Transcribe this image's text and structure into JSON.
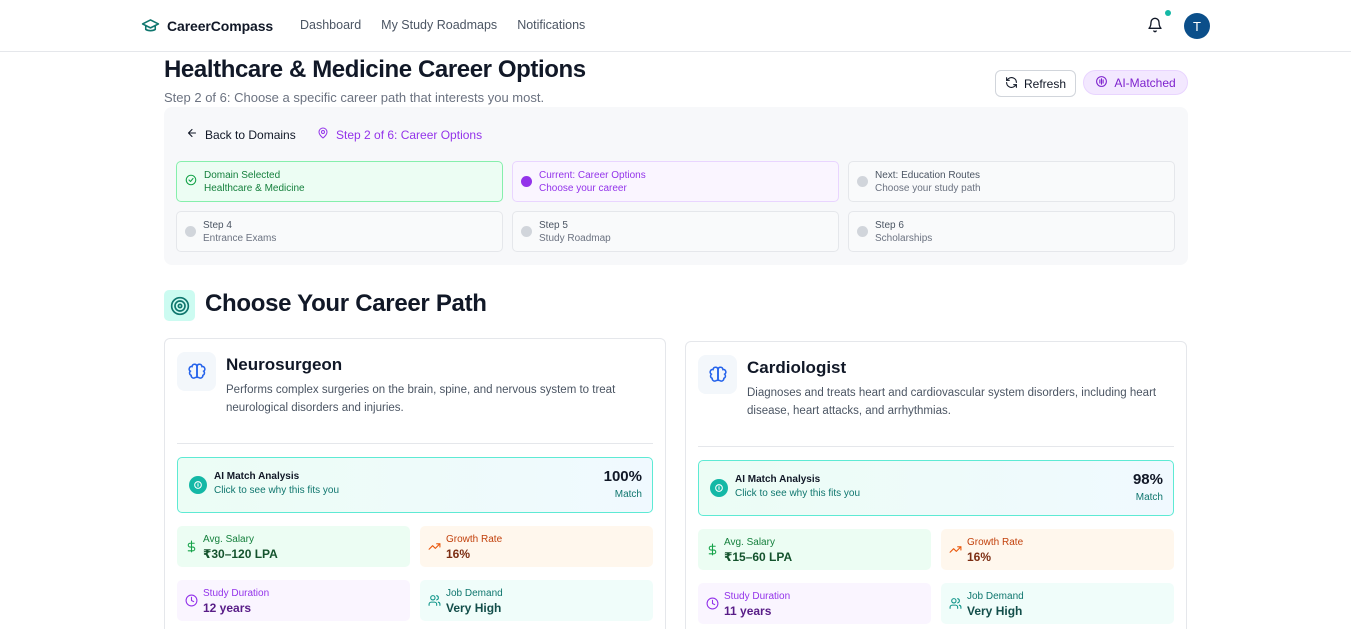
{
  "nav": {
    "brand": "CareerCompass",
    "links": [
      "Dashboard",
      "My Study Roadmaps",
      "Notifications"
    ],
    "avatar_initial": "T"
  },
  "header": {
    "title": "Healthcare & Medicine Career Options",
    "subtitle": "Step 2 of 6: Choose a specific career path that interests you most.",
    "refresh_label": "Refresh",
    "ai_badge": "AI-Matched"
  },
  "progress": {
    "back_label": "Back to Domains",
    "step_label": "Step 2 of 6: Career Options",
    "steps": [
      {
        "title": "Domain Selected",
        "sub": "Healthcare & Medicine",
        "state": "done"
      },
      {
        "title": "Current: Career Options",
        "sub": "Choose your career",
        "state": "current"
      },
      {
        "title": "Next: Education Routes",
        "sub": "Choose your study path",
        "state": "upcoming"
      },
      {
        "title": "Step 4",
        "sub": "Entrance Exams",
        "state": "upcoming"
      },
      {
        "title": "Step 5",
        "sub": "Study Roadmap",
        "state": "upcoming"
      },
      {
        "title": "Step 6",
        "sub": "Scholarships",
        "state": "upcoming"
      }
    ]
  },
  "section": {
    "title": "Choose Your Career Path"
  },
  "careers": [
    {
      "name": "Neurosurgeon",
      "description": "Performs complex surgeries on the brain, spine, and nervous system to treat neurological disorders and injuries.",
      "ai_title": "AI Match Analysis",
      "ai_sub": "Click to see why this fits you",
      "match": "100%",
      "match_label": "Match",
      "salary_label": "Avg. Salary",
      "salary": "₹30–120 LPA",
      "growth_label": "Growth Rate",
      "growth": "16%",
      "duration_label": "Study Duration",
      "duration": "12 years",
      "demand_label": "Job Demand",
      "demand": "Very High"
    },
    {
      "name": "Cardiologist",
      "description": "Diagnoses and treats heart and cardiovascular system disorders, including heart disease, heart attacks, and arrhythmias.",
      "ai_title": "AI Match Analysis",
      "ai_sub": "Click to see why this fits you",
      "match": "98%",
      "match_label": "Match",
      "salary_label": "Avg. Salary",
      "salary": "₹15–60 LPA",
      "growth_label": "Growth Rate",
      "growth": "16%",
      "duration_label": "Study Duration",
      "duration": "11 years",
      "demand_label": "Job Demand",
      "demand": "Very High"
    }
  ],
  "colors": {
    "accent_teal": "#14b8a6",
    "accent_purple": "#9333ea",
    "avatar_blue": "#0b4f8a"
  }
}
